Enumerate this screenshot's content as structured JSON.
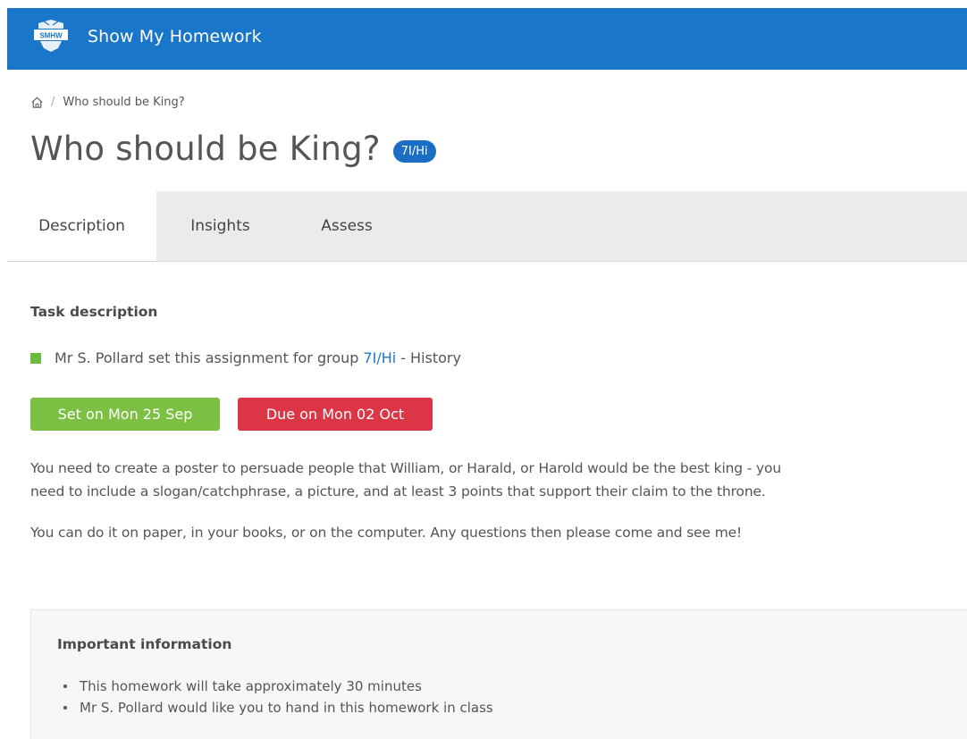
{
  "header": {
    "logo_text": "SMHW",
    "app_title": "Show My Homework",
    "bar_color": "#1a76c9"
  },
  "breadcrumb": {
    "home_icon": "home-icon",
    "separator": "/",
    "current": "Who should be King?"
  },
  "page": {
    "title": "Who should be King?",
    "group_badge": "7I/Hi"
  },
  "tabs": [
    {
      "label": "Description",
      "active": true
    },
    {
      "label": "Insights",
      "active": false
    },
    {
      "label": "Assess",
      "active": false
    }
  ],
  "task": {
    "heading": "Task description",
    "setter_prefix": "Mr S. Pollard set this assignment for group",
    "group_link": "7I/Hi",
    "subject_suffix": "- History",
    "set_on": "Set on Mon 25 Sep",
    "due_on": "Due on Mon 02 Oct",
    "description_line1": "You need to create a poster to persuade people that William, or Harald, or Harold would be the best king - you",
    "description_line2": "need to include a slogan/catchphrase, a picture, and at least 3 points that support their claim to the throne.",
    "description_line3": "You can do it on paper, in your books, or on the computer. Any questions then please come and see me!",
    "colors": {
      "set_badge": "#7bc043",
      "due_badge": "#dc3545",
      "status_square": "#6dba41"
    }
  },
  "important_info": {
    "heading": "Important information",
    "items": [
      "This homework will take approximately 30 minutes",
      "Mr S. Pollard would like you to hand in this homework in class"
    ]
  }
}
